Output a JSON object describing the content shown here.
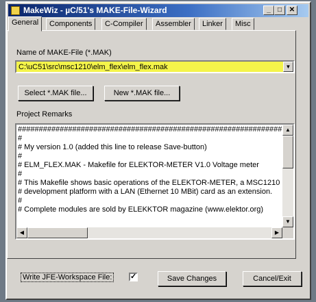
{
  "window": {
    "title": "MakeWiz - µC/51's MAKE-File-Wizard",
    "minimize": "_",
    "maximize": "□",
    "close": "✕"
  },
  "tabs": [
    "General",
    "Components",
    "C-Compiler",
    "Assembler",
    "Linker",
    "Misc"
  ],
  "general": {
    "makefile_label": "Name of MAKE-File (*.MAK)",
    "makefile_value": "C:\\uC51\\src\\msc1210\\elm_flex\\elm_flex.mak",
    "select_button": "Select *.MAK file...",
    "new_button": "New *.MAK file...",
    "remarks_label": "Project Remarks",
    "remarks_lines": [
      "##################################################################",
      "#",
      "# My version 1.0 (added this line to release Save-button)",
      "#",
      "# ELM_FLEX.MAK  - Makefile for ELEKTOR-METER V1.0 Voltage meter",
      "#",
      "# This Makefile shows basic operations of the ELEKTOR-METER, a MSC1210",
      "# development platform with a LAN (Ethernet 10 MBit) card as an extension.",
      "#",
      "# Complete modules are sold by ELEKKTOR magazine (www.elektor.org)"
    ]
  },
  "footer": {
    "write_label": "Write JFE-Workspace File:",
    "write_checked": "✓",
    "save_button": "Save Changes",
    "cancel_button": "Cancel/Exit"
  },
  "colors": {
    "accent_field": "#f4f44a",
    "title_bar": "#0a246a"
  }
}
